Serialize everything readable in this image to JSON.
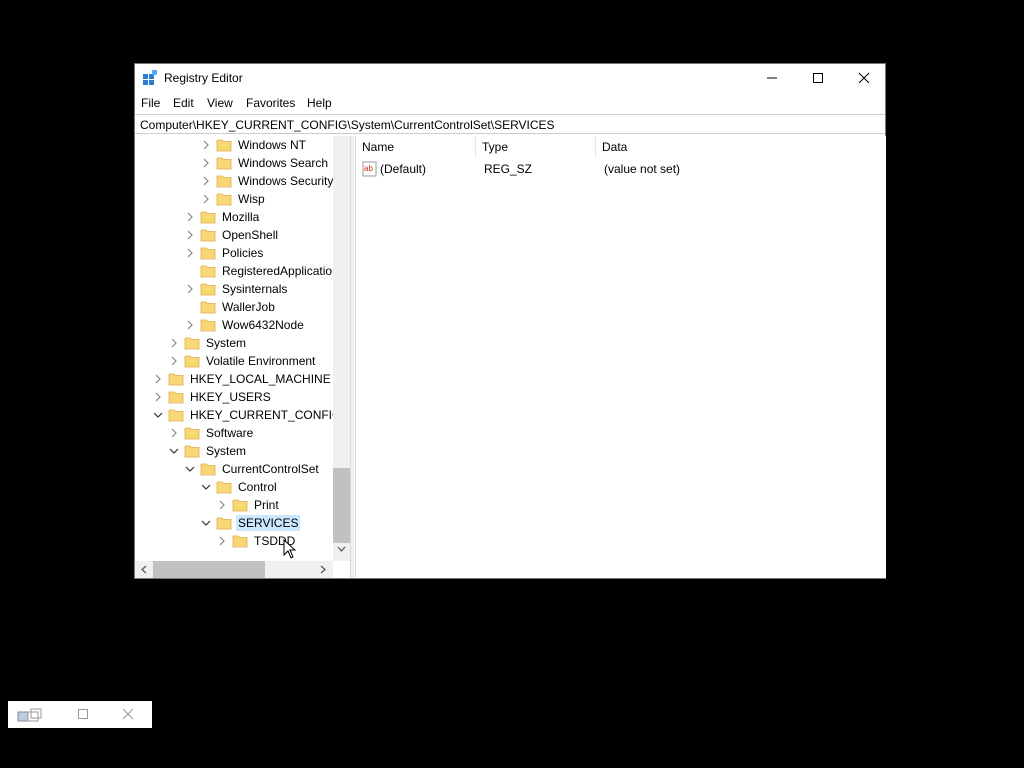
{
  "window": {
    "title": "Registry Editor",
    "menu": [
      "File",
      "Edit",
      "View",
      "Favorites",
      "Help"
    ],
    "address": "Computer\\HKEY_CURRENT_CONFIG\\System\\CurrentControlSet\\SERVICES"
  },
  "tree": {
    "items": [
      {
        "label": "Windows NT",
        "level": 5,
        "expander": "collapsed"
      },
      {
        "label": "Windows Search",
        "level": 5,
        "expander": "collapsed"
      },
      {
        "label": "Windows Security",
        "level": 5,
        "expander": "collapsed"
      },
      {
        "label": "Wisp",
        "level": 5,
        "expander": "collapsed"
      },
      {
        "label": "Mozilla",
        "level": 4,
        "expander": "collapsed"
      },
      {
        "label": "OpenShell",
        "level": 4,
        "expander": "collapsed"
      },
      {
        "label": "Policies",
        "level": 4,
        "expander": "collapsed"
      },
      {
        "label": "RegisteredApplications",
        "level": 4,
        "expander": "none"
      },
      {
        "label": "Sysinternals",
        "level": 4,
        "expander": "collapsed"
      },
      {
        "label": "WallerJob",
        "level": 4,
        "expander": "none"
      },
      {
        "label": "Wow6432Node",
        "level": 4,
        "expander": "collapsed"
      },
      {
        "label": "System",
        "level": 3,
        "expander": "collapsed"
      },
      {
        "label": "Volatile Environment",
        "level": 3,
        "expander": "collapsed"
      },
      {
        "label": "HKEY_LOCAL_MACHINE",
        "level": 2,
        "expander": "collapsed"
      },
      {
        "label": "HKEY_USERS",
        "level": 2,
        "expander": "collapsed"
      },
      {
        "label": "HKEY_CURRENT_CONFIG",
        "level": 2,
        "expander": "expanded"
      },
      {
        "label": "Software",
        "level": 3,
        "expander": "collapsed"
      },
      {
        "label": "System",
        "level": 3,
        "expander": "expanded"
      },
      {
        "label": "CurrentControlSet",
        "level": 4,
        "expander": "expanded"
      },
      {
        "label": "Control",
        "level": 5,
        "expander": "expanded"
      },
      {
        "label": "Print",
        "level": 6,
        "expander": "collapsed"
      },
      {
        "label": "SERVICES",
        "level": 5,
        "expander": "expanded",
        "selected": true
      },
      {
        "label": "TSDDD",
        "level": 6,
        "expander": "collapsed"
      }
    ]
  },
  "list": {
    "columns": [
      "Name",
      "Type",
      "Data"
    ],
    "rows": [
      {
        "name": "(Default)",
        "type": "REG_SZ",
        "data": "(value not set)",
        "icon": "string-value-icon"
      }
    ]
  },
  "colors": {
    "selection": "#cce8ff",
    "folder": "#f8d775",
    "folder_edge": "#dcb04a"
  }
}
